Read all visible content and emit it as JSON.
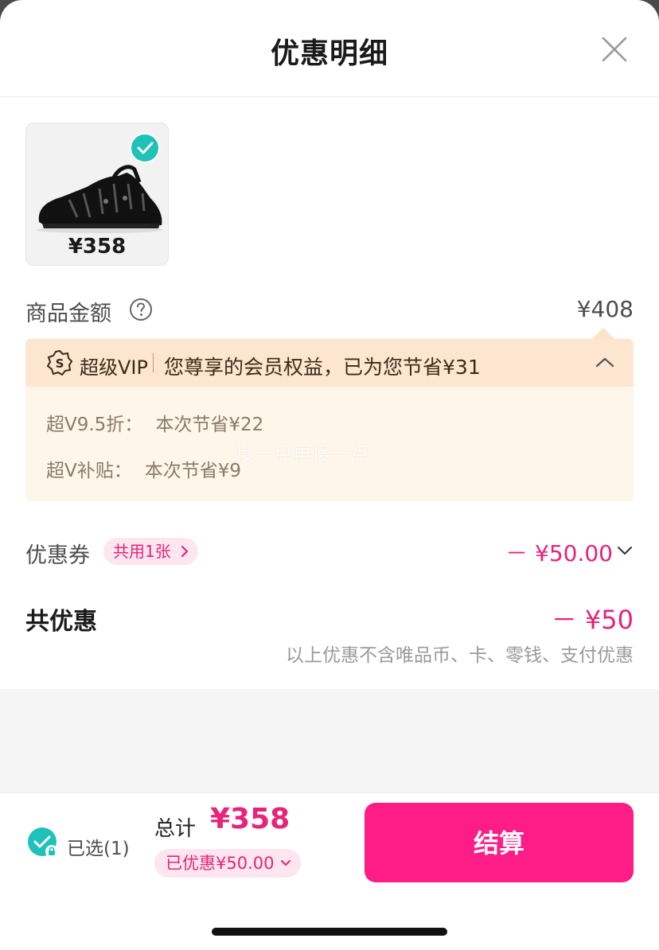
{
  "header": {
    "title": "优惠明细",
    "close_icon": "close-icon"
  },
  "product": {
    "price": "¥358",
    "selected": true,
    "image": "black-sandal-shoe"
  },
  "goods": {
    "label": "商品金额",
    "amount": "¥408",
    "help_icon": "question-circle-icon"
  },
  "vip": {
    "badge": "超级VIP",
    "saving_text": "您尊享的会员权益，已为您节省¥31",
    "expanded": true,
    "lines": [
      {
        "label": "超V9.5折：",
        "value": "本次节省¥22"
      },
      {
        "label": "超V补贴：",
        "value": "本次节省¥9"
      }
    ]
  },
  "watermark": "慢一点再慢一点",
  "coupon": {
    "label": "优惠券",
    "pill": "共用1张",
    "amount": "－ ¥50.00"
  },
  "total_discount": {
    "label": "共优惠",
    "amount": "－ ¥50",
    "note": "以上优惠不含唯品币、卡、零钱、支付优惠"
  },
  "footer": {
    "selected_text": "已选(1)",
    "sum_label": "总计",
    "sum_value": "¥358",
    "discount_pill": "已优惠¥50.00",
    "checkout_label": "结算"
  },
  "colors": {
    "accent": "#fe1c86",
    "pink_text": "#e5247a",
    "teal": "#1ec2b8",
    "vip_bg": "#fff6ea"
  }
}
